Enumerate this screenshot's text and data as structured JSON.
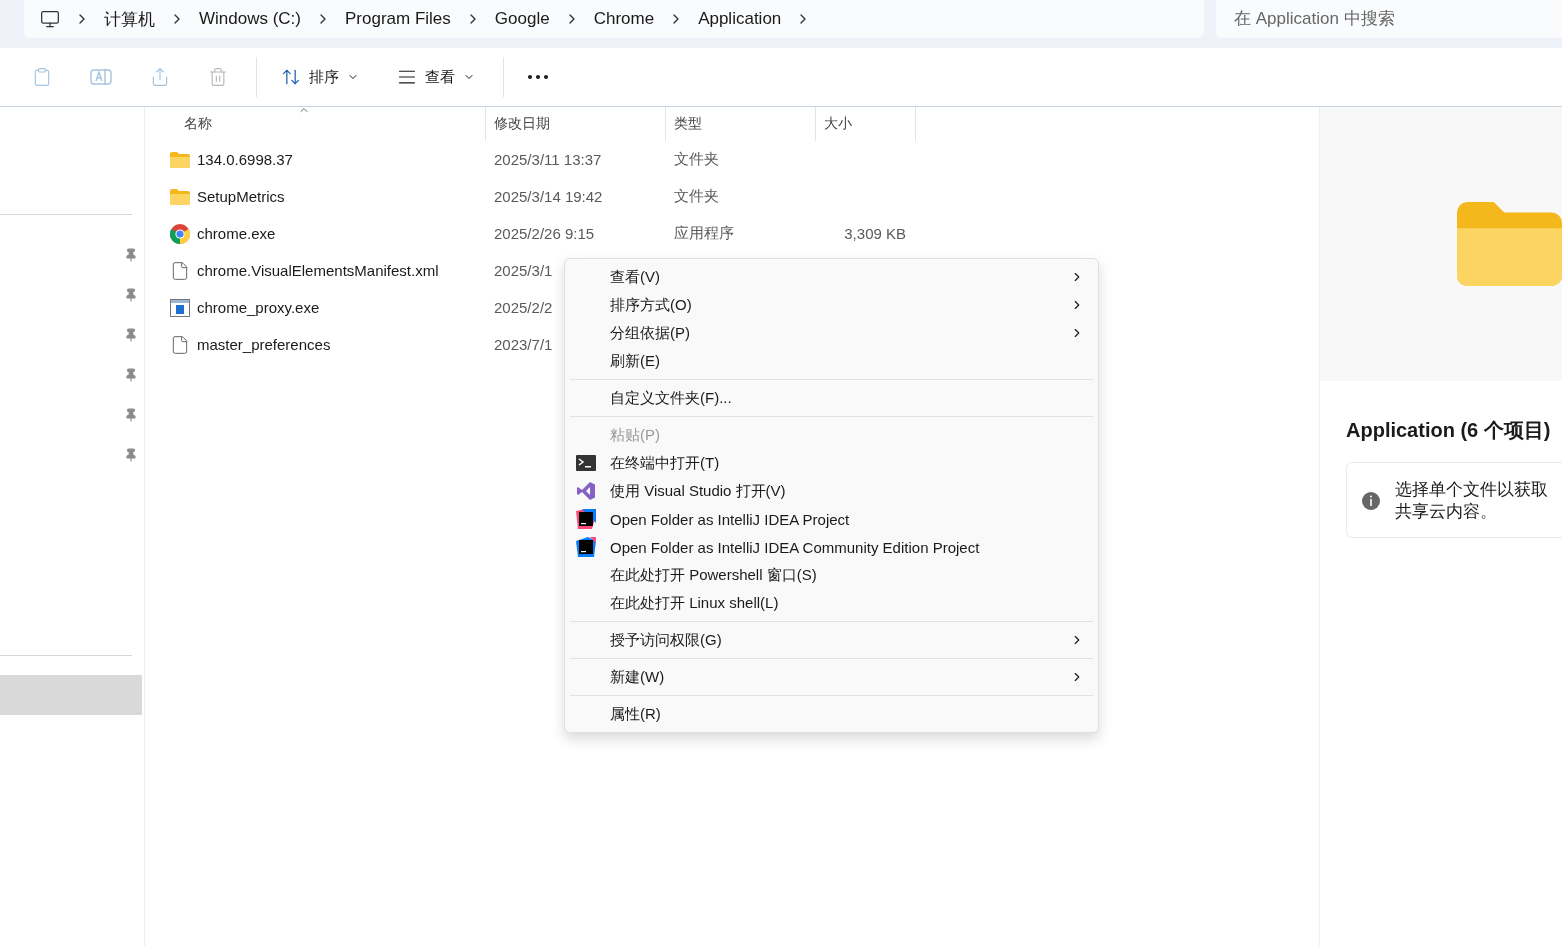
{
  "breadcrumb": [
    "计算机",
    "Windows (C:)",
    "Program Files",
    "Google",
    "Chrome",
    "Application"
  ],
  "search": {
    "placeholder": "在 Application 中搜索"
  },
  "toolbar": {
    "sort": "排序",
    "view": "查看"
  },
  "table": {
    "columns": [
      {
        "label": "名称",
        "sorted": true
      },
      {
        "label": "修改日期",
        "sorted": false
      },
      {
        "label": "类型",
        "sorted": false
      },
      {
        "label": "大小",
        "sorted": false
      }
    ],
    "rows": [
      {
        "kind": "folder",
        "name": "134.0.6998.37",
        "date": "2025/3/11 13:37",
        "type": "文件夹"
      },
      {
        "kind": "folder",
        "name": "SetupMetrics",
        "date": "2025/3/14 19:42",
        "type": "文件夹"
      },
      {
        "kind": "chrome",
        "name": "chrome.exe",
        "date": "2025/2/26 9:15",
        "type": "应用程序",
        "size": "3,309 KB"
      },
      {
        "kind": "file",
        "name": "chrome.VisualElementsManifest.xml",
        "date": "2025/3/1"
      },
      {
        "kind": "exe",
        "name": "chrome_proxy.exe",
        "date": "2025/2/2"
      },
      {
        "kind": "file",
        "name": "master_preferences",
        "date": "2023/7/1"
      }
    ]
  },
  "context_menu": [
    [
      {
        "label": "查看(V)",
        "submenu": true,
        "disabled": false
      },
      {
        "label": "排序方式(O)",
        "submenu": true,
        "disabled": false
      },
      {
        "label": "分组依据(P)",
        "submenu": true,
        "disabled": false
      },
      {
        "label": "刷新(E)",
        "submenu": false,
        "disabled": false
      }
    ],
    [
      {
        "label": "自定义文件夹(F)...",
        "submenu": false,
        "disabled": false
      }
    ],
    [
      {
        "label": "粘贴(P)",
        "submenu": false,
        "disabled": true
      },
      {
        "label": "在终端中打开(T)",
        "submenu": false,
        "disabled": false,
        "kind": "terminal"
      },
      {
        "label": "使用 Visual Studio 打开(V)",
        "submenu": false,
        "disabled": false,
        "kind": "vs"
      },
      {
        "label": "Open Folder as IntelliJ IDEA Project",
        "submenu": false,
        "disabled": false,
        "kind": "idea"
      },
      {
        "label": "Open Folder as IntelliJ IDEA Community Edition Project",
        "submenu": false,
        "disabled": false,
        "kind": "idea-ce"
      },
      {
        "label": "在此处打开 Powershell 窗口(S)",
        "submenu": false,
        "disabled": false
      },
      {
        "label": "在此处打开 Linux shell(L)",
        "submenu": false,
        "disabled": false
      }
    ],
    [
      {
        "label": "授予访问权限(G)",
        "submenu": true,
        "disabled": false
      }
    ],
    [
      {
        "label": "新建(W)",
        "submenu": true,
        "disabled": false
      }
    ],
    [
      {
        "label": "属性(R)",
        "submenu": false,
        "disabled": false
      }
    ]
  ],
  "preview": {
    "title": "Application (6 个项目)",
    "info_lines": [
      "选择单个文件以获取",
      "共享云内容。"
    ]
  }
}
